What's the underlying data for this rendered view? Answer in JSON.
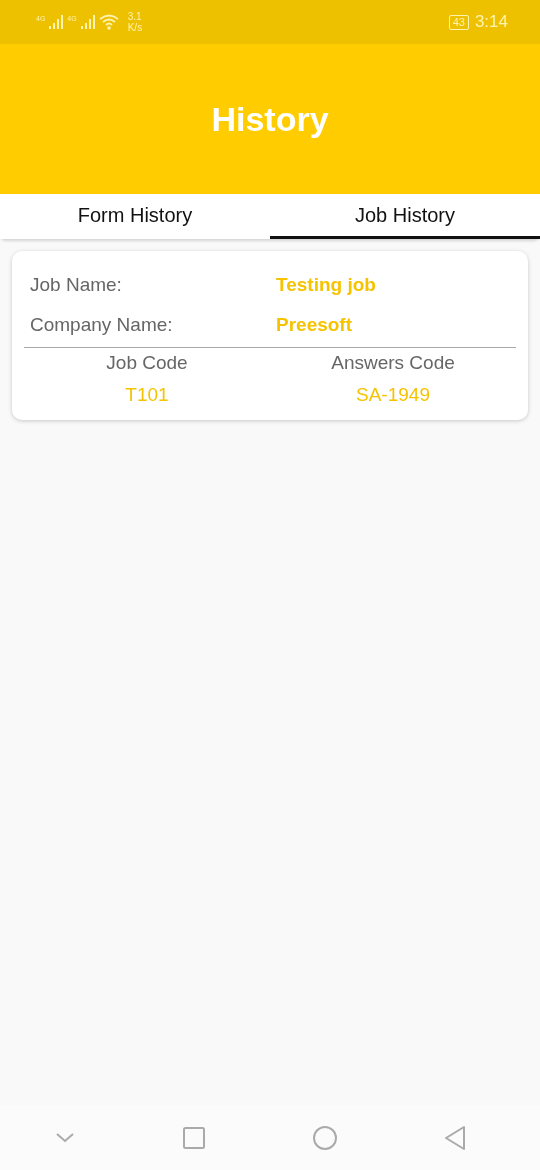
{
  "status_bar": {
    "networks": [
      "4G",
      "4G"
    ],
    "speed": "3.1",
    "speed_unit": "K/s",
    "battery": "43",
    "time": "3:14"
  },
  "header": {
    "title": "History"
  },
  "tabs": [
    {
      "label": "Form History",
      "selected": false
    },
    {
      "label": "Job History",
      "selected": true
    }
  ],
  "jobs": [
    {
      "fields": [
        {
          "label": "Job Name:",
          "value": "Testing job"
        },
        {
          "label": "Company Name:",
          "value": "Preesoft"
        }
      ],
      "codes": [
        {
          "label": "Job Code",
          "value": "T101"
        },
        {
          "label": "Answers Code",
          "value": "SA-1949"
        }
      ]
    }
  ]
}
